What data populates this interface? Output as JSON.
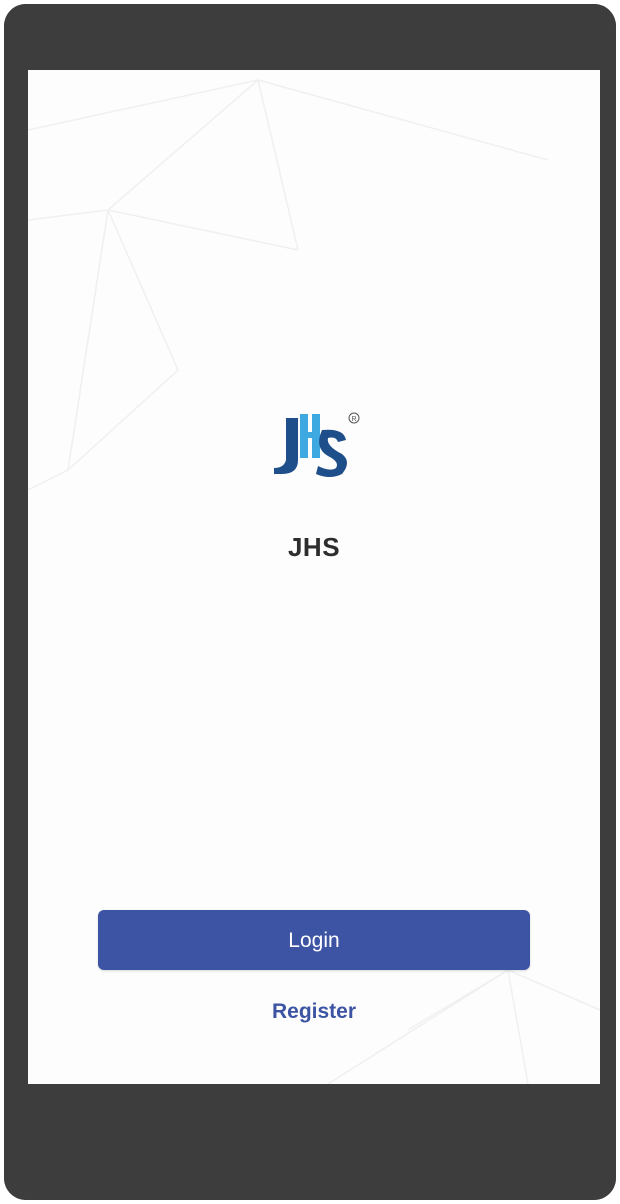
{
  "app": {
    "name": "JHS",
    "logo_icon": "jhs-logo-icon",
    "registered_mark": "®"
  },
  "actions": {
    "login_label": "Login",
    "register_label": "Register"
  },
  "colors": {
    "bezel": "#3d3d3d",
    "screen_background": "#fdfdfd",
    "primary": "#3d54a4",
    "title_text": "#2d2d2d",
    "logo_dark_blue": "#1f4f8a",
    "logo_light_blue": "#3ea8e0"
  }
}
